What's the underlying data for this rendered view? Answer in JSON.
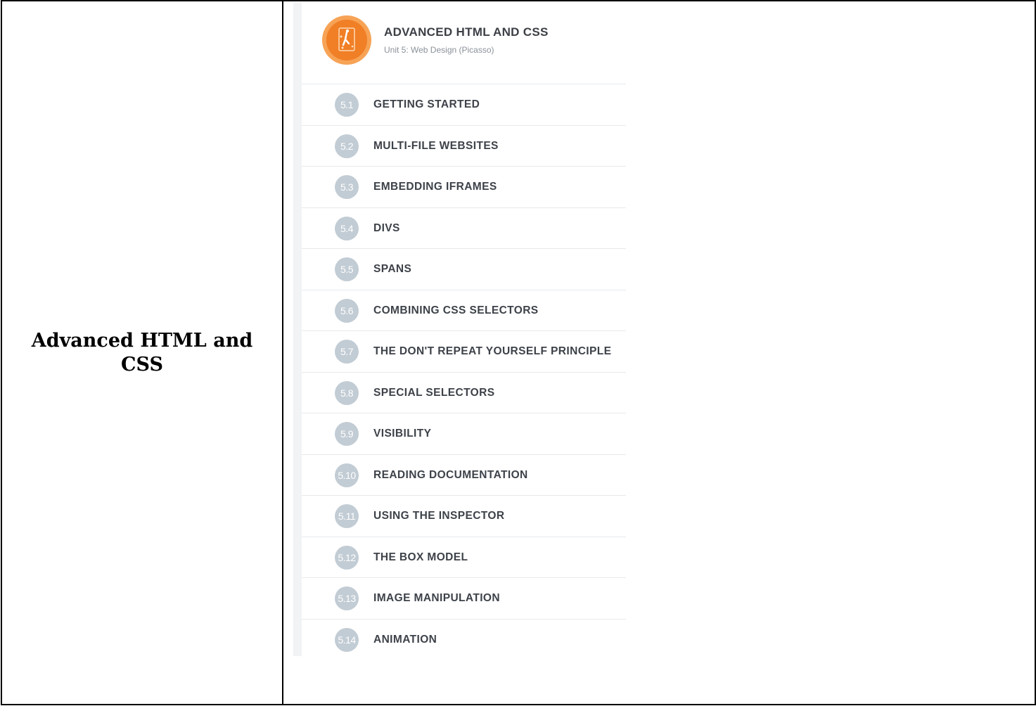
{
  "left_cell": {
    "title": "Advanced HTML and CSS"
  },
  "unit": {
    "title": "ADVANCED HTML AND CSS",
    "subtitle": "Unit 5: Web Design (Picasso)",
    "icon": "picasso-unit-icon",
    "icon_colors": {
      "outer": "#f7a356",
      "inner": "#f07f26"
    }
  },
  "badge_color": "#c2ccd4",
  "lessons": [
    {
      "number": "5.1",
      "label": "GETTING STARTED"
    },
    {
      "number": "5.2",
      "label": "MULTI-FILE WEBSITES"
    },
    {
      "number": "5.3",
      "label": "EMBEDDING IFRAMES"
    },
    {
      "number": "5.4",
      "label": "DIVS"
    },
    {
      "number": "5.5",
      "label": "SPANS"
    },
    {
      "number": "5.6",
      "label": "COMBINING CSS SELECTORS"
    },
    {
      "number": "5.7",
      "label": "THE DON'T REPEAT YOURSELF PRINCIPLE"
    },
    {
      "number": "5.8",
      "label": "SPECIAL SELECTORS"
    },
    {
      "number": "5.9",
      "label": "VISIBILITY"
    },
    {
      "number": "5.10",
      "label": "READING DOCUMENTATION"
    },
    {
      "number": "5.11",
      "label": "USING THE INSPECTOR"
    },
    {
      "number": "5.12",
      "label": "THE BOX MODEL"
    },
    {
      "number": "5.13",
      "label": "IMAGE MANIPULATION"
    },
    {
      "number": "5.14",
      "label": "ANIMATION"
    }
  ]
}
